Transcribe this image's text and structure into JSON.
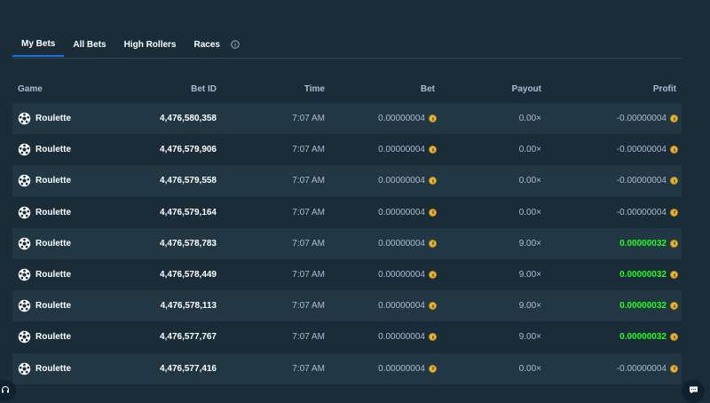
{
  "tabs": [
    {
      "label": "My Bets",
      "active": true
    },
    {
      "label": "All Bets",
      "active": false
    },
    {
      "label": "High Rollers",
      "active": false
    },
    {
      "label": "Races",
      "active": false
    }
  ],
  "table": {
    "headers": {
      "game": "Game",
      "bet_id": "Bet ID",
      "time": "Time",
      "bet": "Bet",
      "payout": "Payout",
      "profit": "Profit"
    },
    "rows": [
      {
        "game": "Roulette",
        "bet_id": "4,476,580,358",
        "time": "7:07 AM",
        "bet": "0.00000004",
        "payout": "0.00×",
        "profit": "-0.00000004",
        "win": false
      },
      {
        "game": "Roulette",
        "bet_id": "4,476,579,906",
        "time": "7:07 AM",
        "bet": "0.00000004",
        "payout": "0.00×",
        "profit": "-0.00000004",
        "win": false
      },
      {
        "game": "Roulette",
        "bet_id": "4,476,579,558",
        "time": "7:07 AM",
        "bet": "0.00000004",
        "payout": "0.00×",
        "profit": "-0.00000004",
        "win": false
      },
      {
        "game": "Roulette",
        "bet_id": "4,476,579,164",
        "time": "7:07 AM",
        "bet": "0.00000004",
        "payout": "0.00×",
        "profit": "-0.00000004",
        "win": false
      },
      {
        "game": "Roulette",
        "bet_id": "4,476,578,783",
        "time": "7:07 AM",
        "bet": "0.00000004",
        "payout": "9.00×",
        "profit": "0.00000032",
        "win": true
      },
      {
        "game": "Roulette",
        "bet_id": "4,476,578,449",
        "time": "7:07 AM",
        "bet": "0.00000004",
        "payout": "9.00×",
        "profit": "0.00000032",
        "win": true
      },
      {
        "game": "Roulette",
        "bet_id": "4,476,578,113",
        "time": "7:07 AM",
        "bet": "0.00000004",
        "payout": "9.00×",
        "profit": "0.00000032",
        "win": true
      },
      {
        "game": "Roulette",
        "bet_id": "4,476,577,767",
        "time": "7:07 AM",
        "bet": "0.00000004",
        "payout": "9.00×",
        "profit": "0.00000032",
        "win": true
      },
      {
        "game": "Roulette",
        "bet_id": "4,476,577,416",
        "time": "7:07 AM",
        "bet": "0.00000004",
        "payout": "0.00×",
        "profit": "-0.00000004",
        "win": false
      }
    ]
  },
  "icons": {
    "game": "roulette-icon",
    "currency": "coin-icon",
    "info": "info-icon",
    "support": "headset-icon",
    "chat": "chat-icon"
  },
  "colors": {
    "background": "#1a2c38",
    "row_alt": "#213743",
    "win": "#1fff20",
    "muted": "#b1bad3",
    "active_tab": "#1475e1"
  }
}
